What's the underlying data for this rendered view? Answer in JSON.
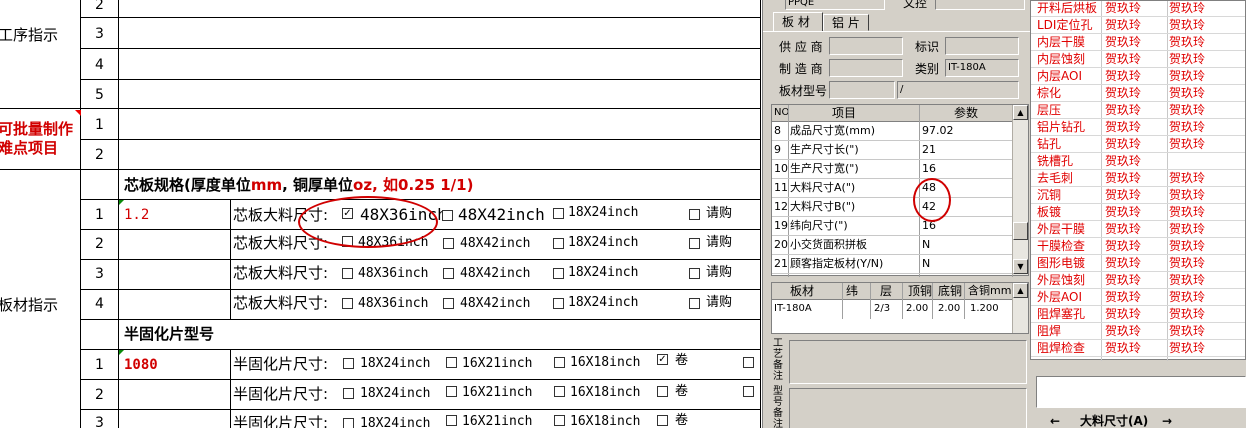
{
  "left": {
    "section_labels": {
      "process": "工序指示",
      "batch_line1": "可批量制作",
      "batch_line2": "难点项目",
      "board": "板材指示"
    },
    "top_rows": [
      "2",
      "3",
      "4",
      "5"
    ],
    "batch_rows": [
      "1",
      "2"
    ],
    "core_header": {
      "prefix": "芯板规格(厚度单位",
      "mm": "mm",
      "mid": ", 铜厚单位",
      "oz": "oz",
      "suffix": ", 如0.25 1/1)"
    },
    "core_rows": [
      {
        "no": "1",
        "value": "1.2",
        "label": "芯板大料尺寸:",
        "opt1": "48X36inch",
        "opt2": "48X42inch",
        "opt3": "18X24inch",
        "buy": "请购",
        "checked": true
      },
      {
        "no": "2",
        "value": "",
        "label": "芯板大料尺寸:",
        "opt1": "48X36inch",
        "opt2": "48X42inch",
        "opt3": "18X24inch",
        "buy": "请购",
        "checked": false
      },
      {
        "no": "3",
        "value": "",
        "label": "芯板大料尺寸:",
        "opt1": "48X36inch",
        "opt2": "48X42inch",
        "opt3": "18X24inch",
        "buy": "请购",
        "checked": false
      },
      {
        "no": "4",
        "value": "",
        "label": "芯板大料尺寸:",
        "opt1": "48X36inch",
        "opt2": "48X42inch",
        "opt3": "18X24inch",
        "buy": "请购",
        "checked": false
      }
    ],
    "prepreg_header": "半固化片型号",
    "prepreg_rows": [
      {
        "no": "1",
        "value": "1080",
        "label": "半固化片尺寸:",
        "opt1": "18X24inch",
        "opt2": "16X21inch",
        "opt3": "16X18inch",
        "roll": "卷",
        "checked": true
      },
      {
        "no": "2",
        "value": "",
        "label": "半固化片尺寸:",
        "opt1": "18X24inch",
        "opt2": "16X21inch",
        "opt3": "16X18inch",
        "roll": "卷",
        "checked": false
      },
      {
        "no": "3",
        "value": "",
        "label": "半固化片尺寸:",
        "opt1": "18X24inch",
        "opt2": "16X21inch",
        "opt3": "16X18inch",
        "roll": "卷",
        "checked": false
      }
    ]
  },
  "mid": {
    "top_labels": [
      "PPQE",
      "文控"
    ],
    "tabs": [
      "板 材",
      "铝 片"
    ],
    "fields": {
      "supplier_label": "供 应 商",
      "mark_label": "标识",
      "maker_label": "制 造 商",
      "type_label": "类别",
      "type_value": "IT-180A",
      "model_label": "板材型号",
      "model_value": "/"
    },
    "param_headers": [
      "NO",
      "项目",
      "参数"
    ],
    "params": [
      {
        "no": "8",
        "item": "成品尺寸宽(mm)",
        "val": "97.02"
      },
      {
        "no": "9",
        "item": "生产尺寸长(\")",
        "val": "21"
      },
      {
        "no": "10",
        "item": "生产尺寸宽(\")",
        "val": "16"
      },
      {
        "no": "11",
        "item": "大料尺寸A(\")",
        "val": "48"
      },
      {
        "no": "12",
        "item": "大料尺寸B(\")",
        "val": "42"
      },
      {
        "no": "19",
        "item": "纬向尺寸(\")",
        "val": "16"
      },
      {
        "no": "20",
        "item": "小交货面积拼板",
        "val": "N"
      },
      {
        "no": "21",
        "item": "顾客指定板材(Y/N)",
        "val": "N"
      }
    ],
    "mat_headers": [
      "板材",
      "纬",
      "层",
      "顶铜",
      "底铜",
      "含铜mm"
    ],
    "mat_row": [
      "IT-180A",
      "",
      "2/3",
      "2.00",
      "2.00",
      "1.200"
    ],
    "note_label1": "工艺备注",
    "note_label2": "型号备注"
  },
  "right": {
    "rows": [
      {
        "name": "开料后烘板",
        "a": "贺玖玲",
        "b": "贺玖玲"
      },
      {
        "name": "LDI定位孔",
        "a": "贺玖玲",
        "b": "贺玖玲"
      },
      {
        "name": "内层干膜",
        "a": "贺玖玲",
        "b": "贺玖玲"
      },
      {
        "name": "内层蚀刻",
        "a": "贺玖玲",
        "b": "贺玖玲"
      },
      {
        "name": "内层AOI",
        "a": "贺玖玲",
        "b": "贺玖玲"
      },
      {
        "name": "棕化",
        "a": "贺玖玲",
        "b": "贺玖玲"
      },
      {
        "name": "层压",
        "a": "贺玖玲",
        "b": "贺玖玲"
      },
      {
        "name": "铝片钻孔",
        "a": "贺玖玲",
        "b": "贺玖玲"
      },
      {
        "name": "钻孔",
        "a": "贺玖玲",
        "b": "贺玖玲"
      },
      {
        "name": "铣槽孔",
        "a": "贺玖玲",
        "b": ""
      },
      {
        "name": "去毛刺",
        "a": "贺玖玲",
        "b": "贺玖玲"
      },
      {
        "name": "沉铜",
        "a": "贺玖玲",
        "b": "贺玖玲"
      },
      {
        "name": "板镀",
        "a": "贺玖玲",
        "b": "贺玖玲"
      },
      {
        "name": "外层干膜",
        "a": "贺玖玲",
        "b": "贺玖玲"
      },
      {
        "name": "干膜检查",
        "a": "贺玖玲",
        "b": "贺玖玲"
      },
      {
        "name": "图形电镀",
        "a": "贺玖玲",
        "b": "贺玖玲"
      },
      {
        "name": "外层蚀刻",
        "a": "贺玖玲",
        "b": "贺玖玲"
      },
      {
        "name": "外层AOI",
        "a": "贺玖玲",
        "b": "贺玖玲"
      },
      {
        "name": "阻焊塞孔",
        "a": "贺玖玲",
        "b": "贺玖玲"
      },
      {
        "name": "阻焊",
        "a": "贺玖玲",
        "b": "贺玖玲"
      },
      {
        "name": "阻焊检查",
        "a": "贺玖玲",
        "b": "贺玖玲"
      }
    ],
    "bottom_label": "大料尺寸(A)",
    "bottom_arrow_left": "←",
    "bottom_arrow_right": "→"
  }
}
